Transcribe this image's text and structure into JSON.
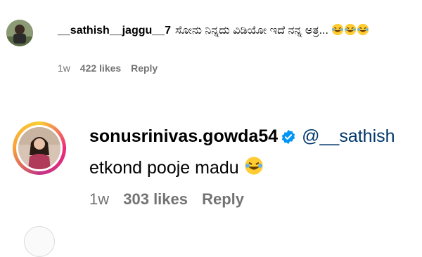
{
  "comments": [
    {
      "username": "__sathish__jaggu__7",
      "text": "ಸೋನು ನಿನ್ನದು ವಿಡಿಯೋ ಇದೆ ನನ್ನ ಅತ್ರ...",
      "emojis": [
        "face-with-tears-of-joy",
        "face-with-tears-of-joy",
        "face-with-tears-of-joy"
      ],
      "time": "1w",
      "likes": "422 likes",
      "reply_label": "Reply"
    },
    {
      "username": "sonusrinivas.gowda54",
      "verified": true,
      "mention": "@__sathish",
      "text": "etkond pooje madu",
      "emojis": [
        "face-with-tears-of-joy"
      ],
      "time": "1w",
      "likes": "303 likes",
      "reply_label": "Reply"
    }
  ],
  "colors": {
    "verified_blue": "#0095f6",
    "mention_blue": "#00376b",
    "meta_gray": "#737373",
    "emoji_yellow": "#ffcc33"
  }
}
